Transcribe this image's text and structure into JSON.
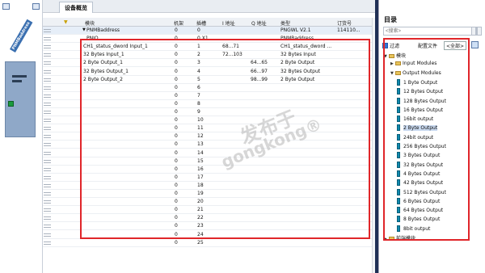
{
  "left_panel": {
    "device_label": "PNMBaddress"
  },
  "main": {
    "tab_label": "设备概览",
    "columns": [
      "模块",
      "机架",
      "插槽",
      "I 地址",
      "Q 地址",
      "类型",
      "订货号"
    ],
    "rows": [
      {
        "module": "PNMBaddress",
        "rack": "0",
        "slot": "0",
        "i": "",
        "q": "",
        "type": "PNGWL V2.1",
        "order": "114110..."
      },
      {
        "module": "PNIO",
        "rack": "0",
        "slot": "0 X1",
        "i": "",
        "q": "",
        "type": "PNMBaddress",
        "order": ""
      },
      {
        "module": "CH1_status_dword Input_1",
        "rack": "0",
        "slot": "1",
        "i": "68...71",
        "q": "",
        "type": "CH1_status_dword ...",
        "order": ""
      },
      {
        "module": "32 Bytes Input_1",
        "rack": "0",
        "slot": "2",
        "i": "72...103",
        "q": "",
        "type": "32 Bytes Input",
        "order": ""
      },
      {
        "module": "2 Byte Output_1",
        "rack": "0",
        "slot": "3",
        "i": "",
        "q": "64...65",
        "type": "2 Byte Output",
        "order": ""
      },
      {
        "module": "32 Bytes Output_1",
        "rack": "0",
        "slot": "4",
        "i": "",
        "q": "66...97",
        "type": "32 Bytes Output",
        "order": ""
      },
      {
        "module": "2 Byte Output_2",
        "rack": "0",
        "slot": "5",
        "i": "",
        "q": "98...99",
        "type": "2 Byte Output",
        "order": ""
      },
      {
        "module": "",
        "rack": "0",
        "slot": "6",
        "i": "",
        "q": "",
        "type": "",
        "order": ""
      },
      {
        "module": "",
        "rack": "0",
        "slot": "7",
        "i": "",
        "q": "",
        "type": "",
        "order": ""
      },
      {
        "module": "",
        "rack": "0",
        "slot": "8",
        "i": "",
        "q": "",
        "type": "",
        "order": ""
      },
      {
        "module": "",
        "rack": "0",
        "slot": "9",
        "i": "",
        "q": "",
        "type": "",
        "order": ""
      },
      {
        "module": "",
        "rack": "0",
        "slot": "10",
        "i": "",
        "q": "",
        "type": "",
        "order": ""
      },
      {
        "module": "",
        "rack": "0",
        "slot": "11",
        "i": "",
        "q": "",
        "type": "",
        "order": ""
      },
      {
        "module": "",
        "rack": "0",
        "slot": "12",
        "i": "",
        "q": "",
        "type": "",
        "order": ""
      },
      {
        "module": "",
        "rack": "0",
        "slot": "13",
        "i": "",
        "q": "",
        "type": "",
        "order": ""
      },
      {
        "module": "",
        "rack": "0",
        "slot": "14",
        "i": "",
        "q": "",
        "type": "",
        "order": ""
      },
      {
        "module": "",
        "rack": "0",
        "slot": "15",
        "i": "",
        "q": "",
        "type": "",
        "order": ""
      },
      {
        "module": "",
        "rack": "0",
        "slot": "16",
        "i": "",
        "q": "",
        "type": "",
        "order": ""
      },
      {
        "module": "",
        "rack": "0",
        "slot": "17",
        "i": "",
        "q": "",
        "type": "",
        "order": ""
      },
      {
        "module": "",
        "rack": "0",
        "slot": "18",
        "i": "",
        "q": "",
        "type": "",
        "order": ""
      },
      {
        "module": "",
        "rack": "0",
        "slot": "19",
        "i": "",
        "q": "",
        "type": "",
        "order": ""
      },
      {
        "module": "",
        "rack": "0",
        "slot": "20",
        "i": "",
        "q": "",
        "type": "",
        "order": ""
      },
      {
        "module": "",
        "rack": "0",
        "slot": "21",
        "i": "",
        "q": "",
        "type": "",
        "order": ""
      },
      {
        "module": "",
        "rack": "0",
        "slot": "22",
        "i": "",
        "q": "",
        "type": "",
        "order": ""
      },
      {
        "module": "",
        "rack": "0",
        "slot": "23",
        "i": "",
        "q": "",
        "type": "",
        "order": ""
      },
      {
        "module": "",
        "rack": "0",
        "slot": "24",
        "i": "",
        "q": "",
        "type": "",
        "order": ""
      },
      {
        "module": "",
        "rack": "0",
        "slot": "25",
        "i": "",
        "q": "",
        "type": "",
        "order": ""
      }
    ],
    "watermark_line1": "发布于",
    "watermark_line2": "gongkong®"
  },
  "catalog": {
    "title": "目录",
    "search_placeholder": "<搜索>",
    "filter_label": "过滤",
    "profile_label": "配置文件",
    "profile_value": "<全部>",
    "tree": [
      {
        "level": 0,
        "label": "模块",
        "expanded": true,
        "folder": true
      },
      {
        "level": 1,
        "label": "Input Modules",
        "expanded": false,
        "folder": true
      },
      {
        "level": 1,
        "label": "Output Modules",
        "expanded": true,
        "folder": true
      },
      {
        "level": 2,
        "label": "1 Byte Output"
      },
      {
        "level": 2,
        "label": "12 Bytes Output"
      },
      {
        "level": 2,
        "label": "128 Bytes Output"
      },
      {
        "level": 2,
        "label": "16 Bytes Output"
      },
      {
        "level": 2,
        "label": "16bit output"
      },
      {
        "level": 2,
        "label": "2 Byte Output",
        "selected": true
      },
      {
        "level": 2,
        "label": "24bit output"
      },
      {
        "level": 2,
        "label": "256 Bytes Output"
      },
      {
        "level": 2,
        "label": "3 Bytes Output"
      },
      {
        "level": 2,
        "label": "32 Bytes Output"
      },
      {
        "level": 2,
        "label": "4 Bytes Output"
      },
      {
        "level": 2,
        "label": "42 Bytes Output"
      },
      {
        "level": 2,
        "label": "512 Bytes Output"
      },
      {
        "level": 2,
        "label": "6 Bytes Output"
      },
      {
        "level": 2,
        "label": "64 Bytes Output"
      },
      {
        "level": 2,
        "label": "8 Bytes Output"
      },
      {
        "level": 2,
        "label": "8bit output"
      },
      {
        "level": 0,
        "label": "前端模块",
        "expanded": false,
        "folder": true
      }
    ]
  }
}
